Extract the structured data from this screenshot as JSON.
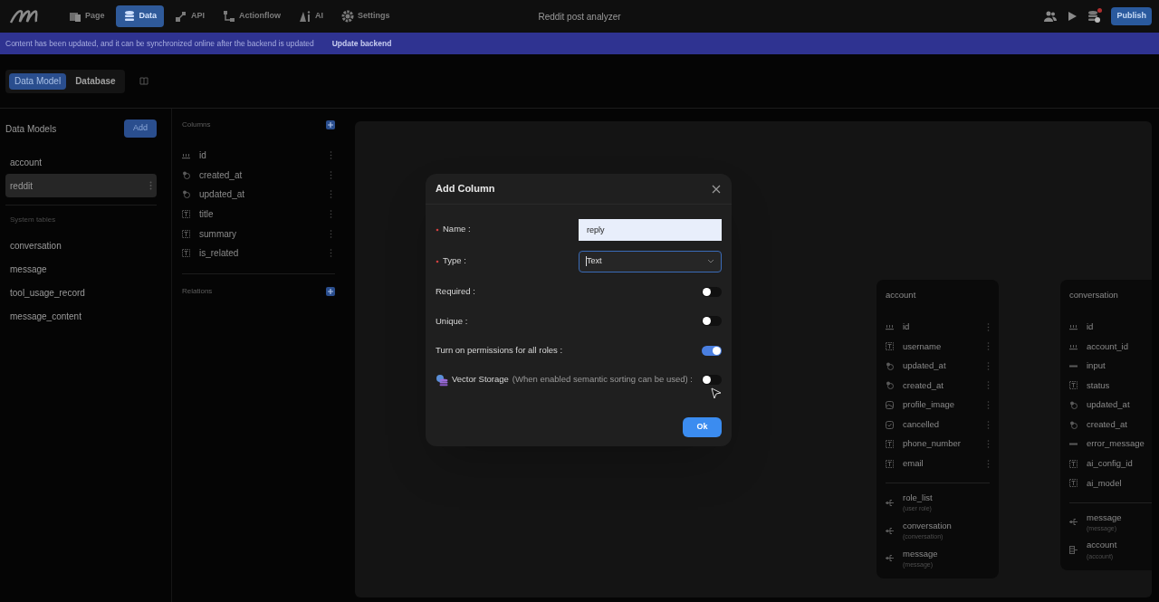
{
  "topbar": {
    "nav": [
      {
        "label": "Page",
        "selected": false
      },
      {
        "label": "Data",
        "selected": true
      },
      {
        "label": "API",
        "selected": false
      },
      {
        "label": "Actionflow",
        "selected": false
      },
      {
        "label": "AI",
        "selected": false
      },
      {
        "label": "Settings",
        "selected": false
      }
    ],
    "title": "Reddit post analyzer",
    "notification": true,
    "publish": "Publish"
  },
  "banner": {
    "message": "Content has been updated, and it can be synchronized online after the backend is updated",
    "action": "Update backend"
  },
  "view_tabs": [
    {
      "label": "Data Model",
      "selected": true
    },
    {
      "label": "Database",
      "selected": false
    }
  ],
  "sidebar": {
    "title": "Data Models",
    "add": "Add",
    "models": [
      {
        "label": "account",
        "selected": false
      },
      {
        "label": "reddit",
        "selected": true
      }
    ],
    "system_title": "System tables",
    "system": [
      {
        "label": "conversation",
        "selected": false
      },
      {
        "label": "message",
        "selected": false
      },
      {
        "label": "tool_usage_record",
        "selected": false
      },
      {
        "label": "message_content",
        "selected": false
      }
    ]
  },
  "columns_panel": {
    "title": "Columns",
    "columns": [
      {
        "name": "id",
        "kind": "number"
      },
      {
        "name": "created_at",
        "kind": "time"
      },
      {
        "name": "updated_at",
        "kind": "time"
      },
      {
        "name": "title",
        "kind": "text"
      },
      {
        "name": "summary",
        "kind": "text"
      },
      {
        "name": "is_related",
        "kind": "text"
      }
    ],
    "relations_title": "Relations"
  },
  "canvas": {
    "tables": [
      {
        "title": "account",
        "columns": [
          {
            "name": "id",
            "kind": "number"
          },
          {
            "name": "username",
            "kind": "text"
          },
          {
            "name": "updated_at",
            "kind": "time"
          },
          {
            "name": "created_at",
            "kind": "time"
          },
          {
            "name": "profile_image",
            "kind": "image"
          },
          {
            "name": "cancelled",
            "kind": "boolean"
          },
          {
            "name": "phone_number",
            "kind": "text"
          },
          {
            "name": "email",
            "kind": "text"
          }
        ],
        "relations": [
          {
            "name": "role_list",
            "target": "(user role)",
            "kind": "many"
          },
          {
            "name": "conversation",
            "target": "(conversation)",
            "kind": "many"
          },
          {
            "name": "message",
            "target": "(message)",
            "kind": "many"
          }
        ]
      },
      {
        "title": "conversation",
        "columns": [
          {
            "name": "id",
            "kind": "number"
          },
          {
            "name": "account_id",
            "kind": "number"
          },
          {
            "name": "input",
            "kind": "string"
          },
          {
            "name": "status",
            "kind": "text"
          },
          {
            "name": "updated_at",
            "kind": "time"
          },
          {
            "name": "created_at",
            "kind": "time"
          },
          {
            "name": "error_message",
            "kind": "string"
          },
          {
            "name": "ai_config_id",
            "kind": "text"
          },
          {
            "name": "ai_model",
            "kind": "text"
          }
        ],
        "relations": [
          {
            "name": "message",
            "target": "(message)",
            "kind": "many"
          },
          {
            "name": "account",
            "target": "(account)",
            "kind": "one"
          }
        ]
      }
    ]
  },
  "dialog": {
    "title": "Add Column",
    "name": {
      "label": "Name :",
      "required": true,
      "value": "reply"
    },
    "type": {
      "label": "Type :",
      "required": true,
      "value": "Text"
    },
    "toggles": [
      {
        "label": "Required :",
        "on": false
      },
      {
        "label": "Unique :",
        "on": false
      },
      {
        "label": "Turn on permissions for all roles :",
        "on": true
      }
    ],
    "vector": {
      "label": "Vector Storage",
      "hint": "(When enabled semantic sorting can be used) :",
      "on": false
    },
    "ok": "Ok"
  }
}
